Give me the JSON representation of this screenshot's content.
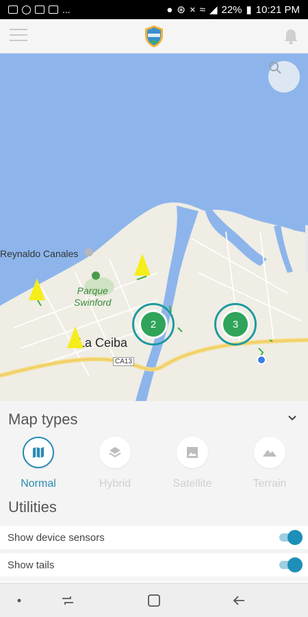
{
  "status_bar": {
    "ellipsis": "...",
    "battery": "22%",
    "time": "10:21 PM"
  },
  "map": {
    "labels": {
      "place": "Reynaldo Canales",
      "park_line1": "Parque",
      "park_line2": "Swinford",
      "city": "La Ceiba",
      "road_shield": "CA13"
    },
    "clusters": [
      {
        "count": "2"
      },
      {
        "count": "3"
      }
    ]
  },
  "sheet": {
    "map_types_title": "Map types",
    "map_types": [
      {
        "label": "Normal",
        "icon": "map-icon",
        "active": true
      },
      {
        "label": "Hybrid",
        "icon": "layers-icon",
        "active": false
      },
      {
        "label": "Satellite",
        "icon": "image-icon",
        "active": false
      },
      {
        "label": "Terrain",
        "icon": "terrain-icon",
        "active": false
      }
    ],
    "utilities_title": "Utilities",
    "utilities": [
      {
        "label": "Show device sensors",
        "enabled": true
      },
      {
        "label": "Show tails",
        "enabled": true
      }
    ]
  },
  "colors": {
    "accent": "#2a8bb3",
    "water": "#8db5ec",
    "land": "#efede4",
    "cluster_green": "#2fa45a",
    "marker_yellow": "#f5ee1a"
  }
}
